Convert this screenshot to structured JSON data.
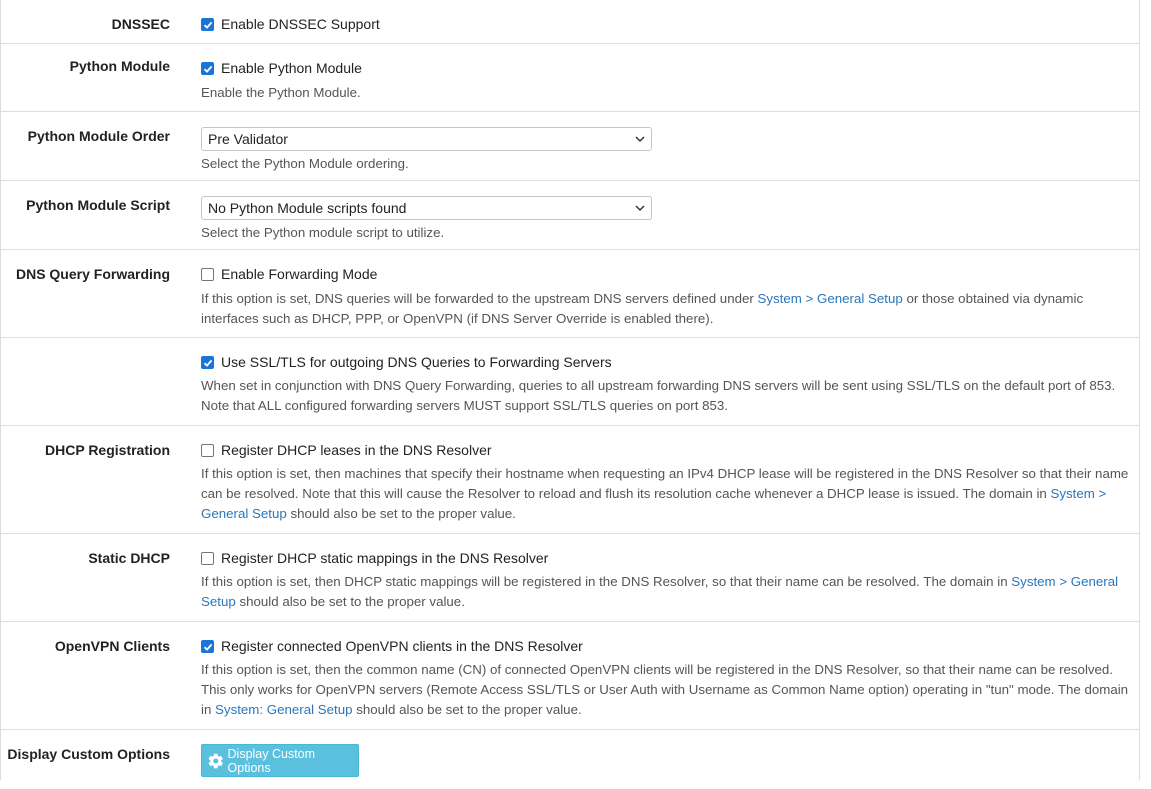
{
  "dnssec": {
    "label": "DNSSEC",
    "checkbox_label": "Enable DNSSEC Support",
    "checked": true
  },
  "python_module": {
    "label": "Python Module",
    "checkbox_label": "Enable Python Module",
    "checked": true,
    "help": "Enable the Python Module."
  },
  "python_module_order": {
    "label": "Python Module Order",
    "selected": "Pre Validator",
    "help": "Select the Python Module ordering."
  },
  "python_module_script": {
    "label": "Python Module Script",
    "selected": "No Python Module scripts found",
    "help": "Select the Python module script to utilize."
  },
  "dns_query_forwarding": {
    "label": "DNS Query Forwarding",
    "checkbox_label": "Enable Forwarding Mode",
    "checked": false,
    "help_pre": "If this option is set, DNS queries will be forwarded to the upstream DNS servers defined under ",
    "help_link": "System > General Setup",
    "help_post": " or those obtained via dynamic interfaces such as DHCP, PPP, or OpenVPN (if DNS Server Override is enabled there)."
  },
  "ssl_tls": {
    "checkbox_label": "Use SSL/TLS for outgoing DNS Queries to Forwarding Servers",
    "checked": true,
    "help": "When set in conjunction with DNS Query Forwarding, queries to all upstream forwarding DNS servers will be sent using SSL/TLS on the default port of 853. Note that ALL configured forwarding servers MUST support SSL/TLS queries on port 853."
  },
  "dhcp_registration": {
    "label": "DHCP Registration",
    "checkbox_label": "Register DHCP leases in the DNS Resolver",
    "checked": false,
    "help_pre": "If this option is set, then machines that specify their hostname when requesting an IPv4 DHCP lease will be registered in the DNS Resolver so that their name can be resolved. Note that this will cause the Resolver to reload and flush its resolution cache whenever a DHCP lease is issued. The domain in ",
    "help_link": "System > General Setup",
    "help_post": " should also be set to the proper value."
  },
  "static_dhcp": {
    "label": "Static DHCP",
    "checkbox_label": "Register DHCP static mappings in the DNS Resolver",
    "checked": false,
    "help_pre": "If this option is set, then DHCP static mappings will be registered in the DNS Resolver, so that their name can be resolved. The domain in ",
    "help_link": "System > General Setup",
    "help_post": " should also be set to the proper value."
  },
  "openvpn_clients": {
    "label": "OpenVPN Clients",
    "checkbox_label": "Register connected OpenVPN clients in the DNS Resolver",
    "checked": true,
    "help_pre": "If this option is set, then the common name (CN) of connected OpenVPN clients will be registered in the DNS Resolver, so that their name can be resolved. This only works for OpenVPN servers (Remote Access SSL/TLS or User Auth with Username as Common Name option) operating in \"tun\" mode. The domain in ",
    "help_link": "System: General Setup",
    "help_post": " should also be set to the proper value."
  },
  "display_custom_options": {
    "label": "Display Custom Options",
    "button_label": "Display Custom Options",
    "icon": "gear-icon"
  },
  "colors": {
    "checkbox_checked": "#1b74d9",
    "link": "#2a76b8",
    "button": "#5bc0de"
  }
}
